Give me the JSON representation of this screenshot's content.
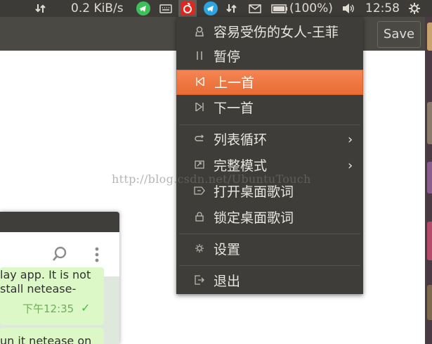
{
  "panel": {
    "net_speed": "0.2 KiB/s",
    "battery_text": "(100%)",
    "clock": "12:58",
    "icons": [
      "transfer-arrows-icon",
      "telegram-icon",
      "keyboard-icon",
      "netease-music-icon",
      "telegram-icon",
      "transfer-arrows-icon",
      "mail-icon",
      "battery-icon",
      "volume-icon",
      "gear-icon"
    ]
  },
  "app": {
    "save_label": "Save"
  },
  "menu": {
    "items": [
      {
        "label": "容易受伤的女人-王菲",
        "icon": "music-note-icon"
      },
      {
        "label": "暂停",
        "icon": "pause-icon"
      },
      {
        "label": "上一首",
        "icon": "previous-icon",
        "active": true
      },
      {
        "label": "下一首",
        "icon": "next-icon"
      },
      {
        "label": "列表循环",
        "icon": "loop-icon",
        "submenu": true
      },
      {
        "label": "完整模式",
        "icon": "fullscreen-icon",
        "submenu": true
      },
      {
        "label": "打开桌面歌词",
        "icon": "lyrics-icon"
      },
      {
        "label": "锁定桌面歌词",
        "icon": "lock-icon"
      },
      {
        "label": "设置",
        "icon": "gear-icon"
      },
      {
        "label": "退出",
        "icon": "exit-icon"
      }
    ],
    "accent": "#f07a45"
  },
  "chat": {
    "bubble1_lines": [
      "lay app. It is not",
      "stall netease-"
    ],
    "bubble1_time": "下午12:35",
    "bubble2_line": "un it netease on"
  },
  "watermark": "http://blog.csdn.net/UbuntuTouch"
}
